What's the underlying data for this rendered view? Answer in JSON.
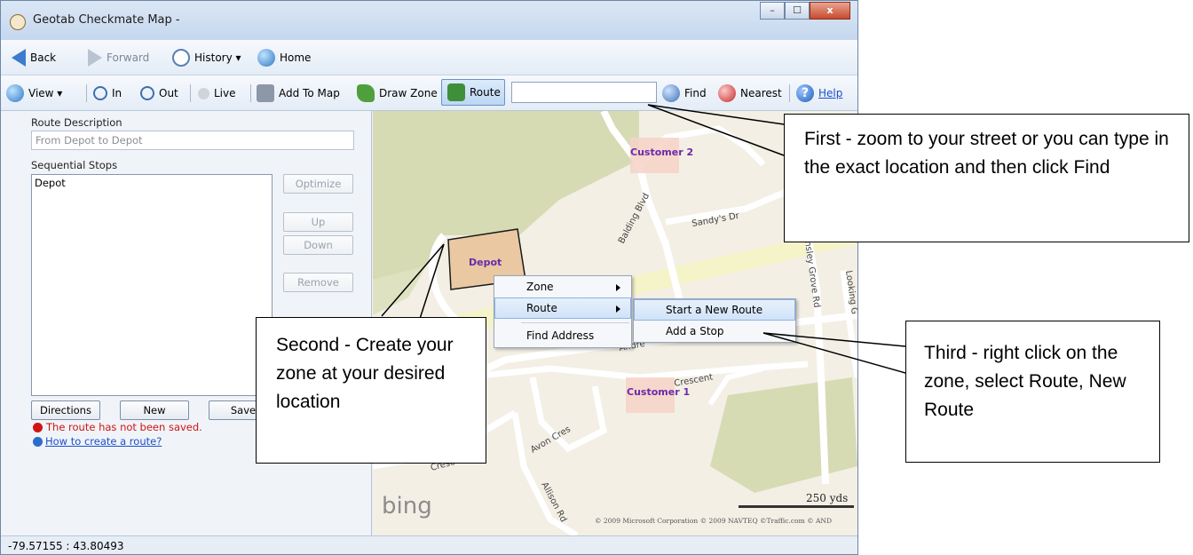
{
  "window": {
    "title": "Geotab Checkmate Map -",
    "controls": {
      "minimize": "–",
      "maximize": "☐",
      "close": "x"
    }
  },
  "nav": {
    "back": "Back",
    "forward": "Forward",
    "history": "History ▾",
    "home": "Home"
  },
  "toolbar": {
    "view": "View ▾",
    "zoom_in": "In",
    "zoom_out": "Out",
    "live": "Live",
    "add_to_map": "Add To Map",
    "draw_zone": "Draw Zone",
    "route": "Route",
    "search_value": "",
    "find": "Find",
    "nearest": "Nearest",
    "help": "Help"
  },
  "panel": {
    "route_description_label": "Route Description",
    "route_description_value": "From Depot to Depot",
    "sequential_stops_label": "Sequential Stops",
    "stops": [
      "Depot"
    ],
    "optimize": "Optimize",
    "up": "Up",
    "down": "Down",
    "remove": "Remove",
    "directions": "Directions",
    "new": "New",
    "save": "Save",
    "warning": "The route has not been saved.",
    "howto": "How to create a route?"
  },
  "map": {
    "labels": {
      "customer2": "Customer 2",
      "customer1": "Customer 1",
      "depot": "Depot",
      "sandys": "Sandy's Dr",
      "balding": "Balding Blvd",
      "ansley": "Ansley Grove Rd",
      "looking": "Looking G",
      "crescent": "Crescent",
      "andre": "Andre",
      "avon": "Avon Cres",
      "allison": "Allison Rd",
      "cresc": "Cresc",
      "scale": "250 yds",
      "copyright": "© 2009 Microsoft Corporation   © 2009 NAVTEQ   ©Traffic.com   © AND",
      "bing": "bing"
    }
  },
  "context_menu": {
    "items": [
      "Zone",
      "Route",
      "Find Address"
    ],
    "submenu": [
      "Start a New Route",
      "Add a Stop"
    ]
  },
  "status": {
    "coords": "-79.57155 : 43.80493"
  },
  "callouts": {
    "first": "First - zoom to your street or you can type in the exact location and then click Find",
    "second": "Second -  Create your zone at your desired location",
    "third": "Third - right click on the zone, select Route, New Route"
  },
  "colors": {
    "park": "#d7dbb4",
    "depot_fill": "#e9c8a2",
    "customer_fill": "#f6d2c8",
    "label_purple": "#6b2aa8",
    "road": "#ffffff",
    "highway": "#f5f3c8"
  }
}
